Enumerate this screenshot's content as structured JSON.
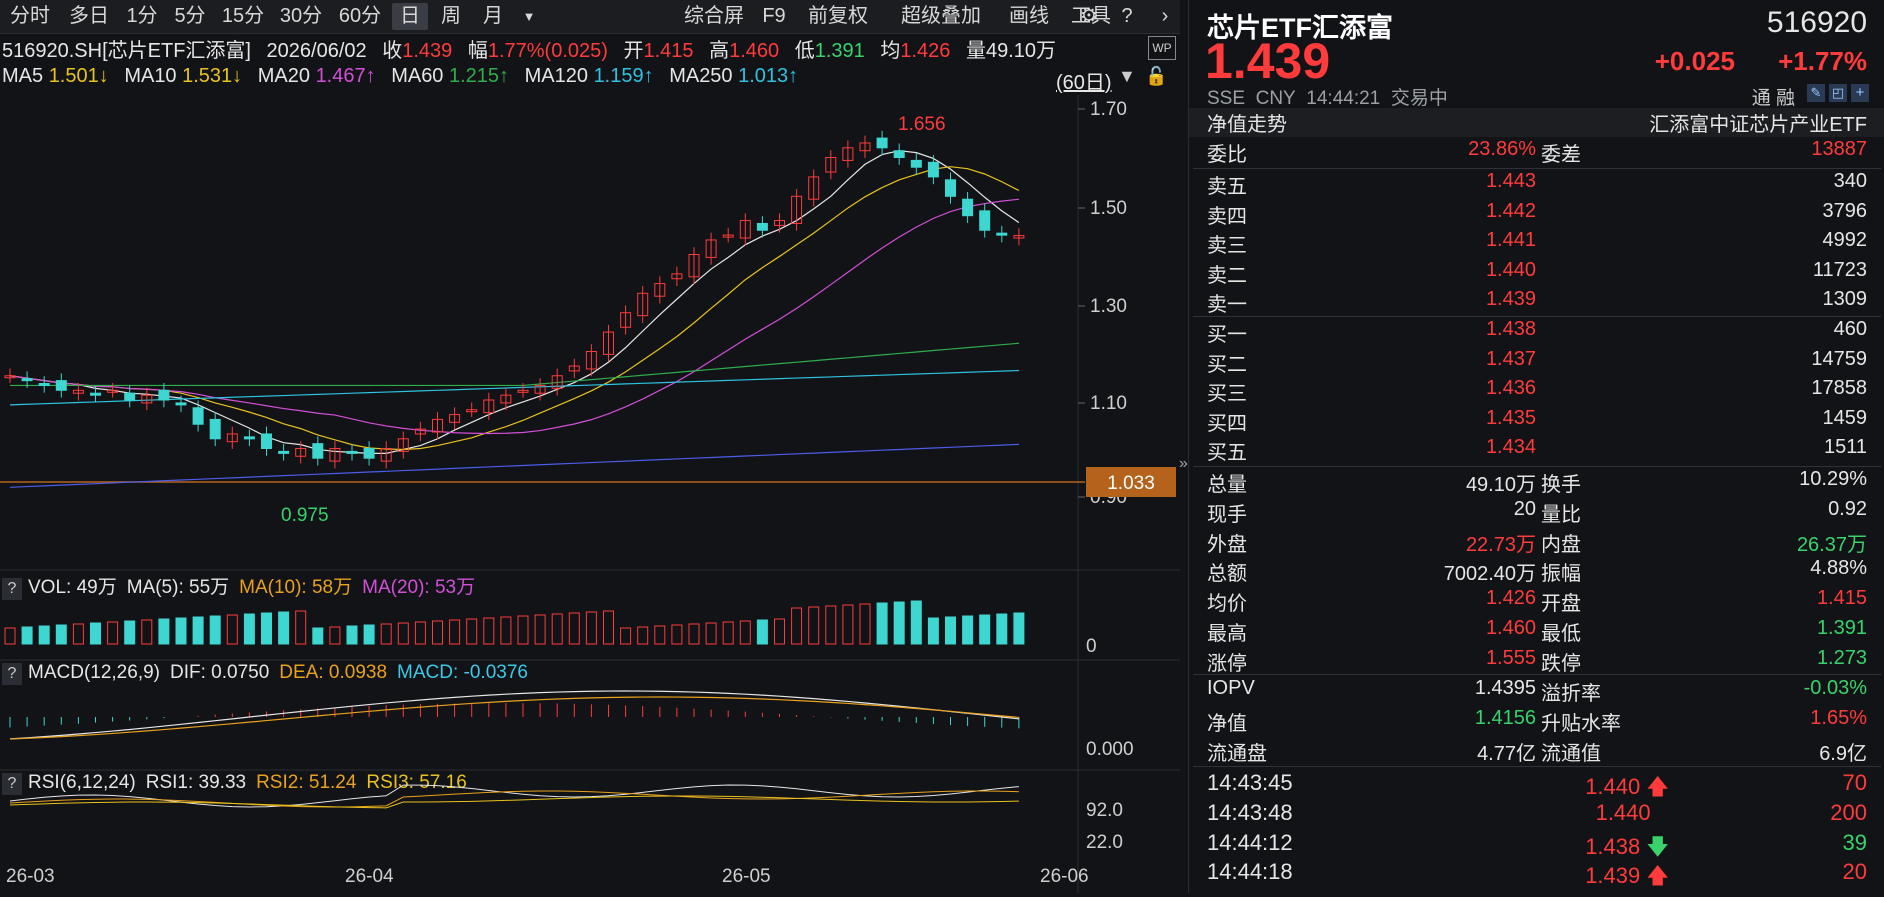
{
  "toolbar": {
    "periods": [
      "分时",
      "多日",
      "1分",
      "5分",
      "15分",
      "30分",
      "60分",
      "日",
      "周",
      "月"
    ],
    "active": "日",
    "tools": [
      "综合屏",
      "F9",
      "前复权",
      "超级叠加",
      "画线",
      "工具"
    ]
  },
  "quote_line": {
    "code_name": "516920.SH[芯片ETF汇添富]",
    "date": "2026/06/02",
    "close_label": "收",
    "close": "1.439",
    "change_label": "幅",
    "change": "1.77%(0.025)",
    "open_label": "开",
    "open": "1.415",
    "high_label": "高",
    "high": "1.460",
    "low_label": "低",
    "low": "1.391",
    "avg_label": "均",
    "avg": "1.426",
    "vol_label": "量",
    "vol": "49.10万"
  },
  "ma_line": {
    "ma5": "MA5",
    "ma5_val": "1.501↓",
    "ma10": "MA10",
    "ma10_val": "1.531↓",
    "ma20": "MA20",
    "ma20_val": "1.467↑",
    "ma60": "MA60",
    "ma60_val": "1.215↑",
    "ma120": "MA120",
    "ma120_val": "1.159↑",
    "ma250": "MA250",
    "ma250_val": "1.013↑",
    "range": "(60日)"
  },
  "price_axis": [
    "1.70",
    "1.50",
    "1.30",
    "1.10",
    "0.90"
  ],
  "price_marker": "1.033",
  "annotations": {
    "high": "1.656",
    "low": "0.975"
  },
  "vol_panel": {
    "q": "?",
    "vol": "VOL: 49万",
    "ma5": "MA(5): 55万",
    "ma10": "MA(10): 58万",
    "ma20": "MA(20): 53万",
    "axis0": "0"
  },
  "macd_panel": {
    "q": "?",
    "title": "MACD(12,26,9)",
    "dif": "DIF: 0.0750",
    "dea": "DEA: 0.0938",
    "macd": "MACD: -0.0376",
    "axis0": "0.000"
  },
  "rsi_panel": {
    "q": "?",
    "title": "RSI(6,12,24)",
    "rsi1": "RSI1: 39.33",
    "rsi2": "RSI2: 51.24",
    "rsi3": "RSI3: 57.16",
    "axis_hi": "92.0",
    "axis_lo": "22.0"
  },
  "date_axis": [
    "26-03",
    "26-04",
    "26-05",
    "26-06"
  ],
  "right": {
    "name": "芯片ETF汇添富",
    "code": "516920",
    "price": "1.439",
    "chg": "+0.025",
    "pct": "+1.77%",
    "exch": "SSE",
    "cur": "CNY",
    "time": "14:44:21",
    "status": "交易中",
    "tong": "通",
    "rong": "融",
    "nav_trend": "净值走势",
    "index_name": "汇添富中证芯片产业ETF",
    "weibi_label": "委比",
    "weibi": "23.86%",
    "weicha_label": "委差",
    "weicha": "13887",
    "asks": [
      {
        "label": "卖五",
        "price": "1.443",
        "vol": "340"
      },
      {
        "label": "卖四",
        "price": "1.442",
        "vol": "3796"
      },
      {
        "label": "卖三",
        "price": "1.441",
        "vol": "4992"
      },
      {
        "label": "卖二",
        "price": "1.440",
        "vol": "11723"
      },
      {
        "label": "卖一",
        "price": "1.439",
        "vol": "1309"
      }
    ],
    "bids": [
      {
        "label": "买一",
        "price": "1.438",
        "vol": "460"
      },
      {
        "label": "买二",
        "price": "1.437",
        "vol": "14759"
      },
      {
        "label": "买三",
        "price": "1.436",
        "vol": "17858"
      },
      {
        "label": "买四",
        "price": "1.435",
        "vol": "1459"
      },
      {
        "label": "买五",
        "price": "1.434",
        "vol": "1511"
      }
    ],
    "stats": [
      {
        "l1": "总量",
        "v1": "49.10万",
        "c1": "white",
        "l2": "换手",
        "v2": "10.29%",
        "c2": "white"
      },
      {
        "l1": "现手",
        "v1": "20",
        "c1": "white",
        "l2": "量比",
        "v2": "0.92",
        "c2": "white"
      },
      {
        "l1": "外盘",
        "v1": "22.73万",
        "c1": "red",
        "l2": "内盘",
        "v2": "26.37万",
        "c2": "green"
      },
      {
        "l1": "总额",
        "v1": "7002.40万",
        "c1": "white",
        "l2": "振幅",
        "v2": "4.88%",
        "c2": "white"
      },
      {
        "l1": "均价",
        "v1": "1.426",
        "c1": "red",
        "l2": "开盘",
        "v2": "1.415",
        "c2": "red"
      },
      {
        "l1": "最高",
        "v1": "1.460",
        "c1": "red",
        "l2": "最低",
        "v2": "1.391",
        "c2": "green"
      },
      {
        "l1": "涨停",
        "v1": "1.555",
        "c1": "red",
        "l2": "跌停",
        "v2": "1.273",
        "c2": "green"
      }
    ],
    "nav_stats": [
      {
        "l1": "IOPV",
        "v1": "1.4395",
        "c1": "white",
        "l2": "溢折率",
        "v2": "-0.03%",
        "c2": "green"
      },
      {
        "l1": "净值",
        "v1": "1.4156",
        "c1": "green",
        "l2": "升贴水率",
        "v2": "1.65%",
        "c2": "red"
      },
      {
        "l1": "流通盘",
        "v1": "4.77亿",
        "c1": "white",
        "l2": "流通值",
        "v2": "6.9亿",
        "c2": "white"
      }
    ],
    "ticks": [
      {
        "time": "14:43:45",
        "price": "1.440",
        "arrow": "up",
        "vol": "70"
      },
      {
        "time": "14:43:48",
        "price": "1.440",
        "arrow": "",
        "vol": "200"
      },
      {
        "time": "14:44:12",
        "price": "1.438",
        "arrow": "down",
        "vol": "39"
      },
      {
        "time": "14:44:18",
        "price": "1.439",
        "arrow": "up",
        "vol": "20"
      }
    ]
  },
  "colors": {
    "up": "#ff3b3b",
    "down": "#3dd6d0",
    "ma5": "#e6e6e6",
    "ma10": "#e8c21e",
    "ma20": "#d34fd8",
    "ma60": "#2fae4e",
    "ma120": "#2ec3e0",
    "ma250": "#4b5ee8",
    "marker": "#b5621c"
  }
}
